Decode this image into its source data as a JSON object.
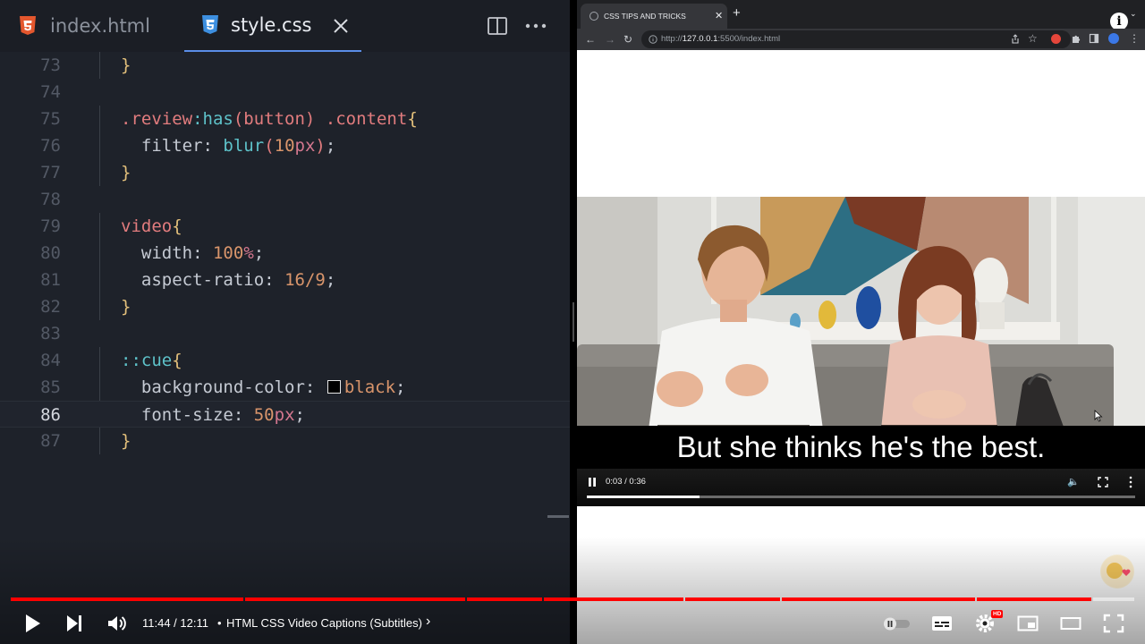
{
  "editor": {
    "tabs": [
      {
        "label": "index.html",
        "icon": "html5-icon"
      },
      {
        "label": "style.css",
        "icon": "css3-icon",
        "active": true
      }
    ],
    "lines": [
      {
        "n": "73",
        "text": "}"
      },
      {
        "n": "74",
        "text": ""
      },
      {
        "n": "75",
        "text": ".review:has(button) .content{"
      },
      {
        "n": "76",
        "text": "  filter: blur(10px);"
      },
      {
        "n": "77",
        "text": "}"
      },
      {
        "n": "78",
        "text": ""
      },
      {
        "n": "79",
        "text": "video{"
      },
      {
        "n": "80",
        "text": "  width: 100%;"
      },
      {
        "n": "81",
        "text": "  aspect-ratio: 16/9;"
      },
      {
        "n": "82",
        "text": "}"
      },
      {
        "n": "83",
        "text": ""
      },
      {
        "n": "84",
        "text": "::cue{"
      },
      {
        "n": "85",
        "text": "  background-color: black;"
      },
      {
        "n": "86",
        "text": "  font-size: 50px;"
      },
      {
        "n": "87",
        "text": "}"
      }
    ],
    "active_line": "86",
    "colors": {
      "background": "#1e222a",
      "selector": "#e27c7e",
      "number": "#d9956b",
      "brace": "#e3c07b",
      "pseudo": "#5ec2c9"
    }
  },
  "browser": {
    "tab_title": "CSS TIPS AND TRICKS",
    "url_prefix": "http://",
    "url_host": "127.0.0.1",
    "url_rest": ":5500/index.html",
    "video": {
      "caption": "But she thinks he's the best.",
      "time": "0:03 / 0:36",
      "progress": 0.205
    }
  },
  "youtube": {
    "time": "11:44 / 12:11",
    "separator": "•",
    "chapter": "HTML CSS Video Captions (Subtitles)",
    "progress": 0.962,
    "hd_badge": "HD",
    "accent": "#ff0000"
  }
}
